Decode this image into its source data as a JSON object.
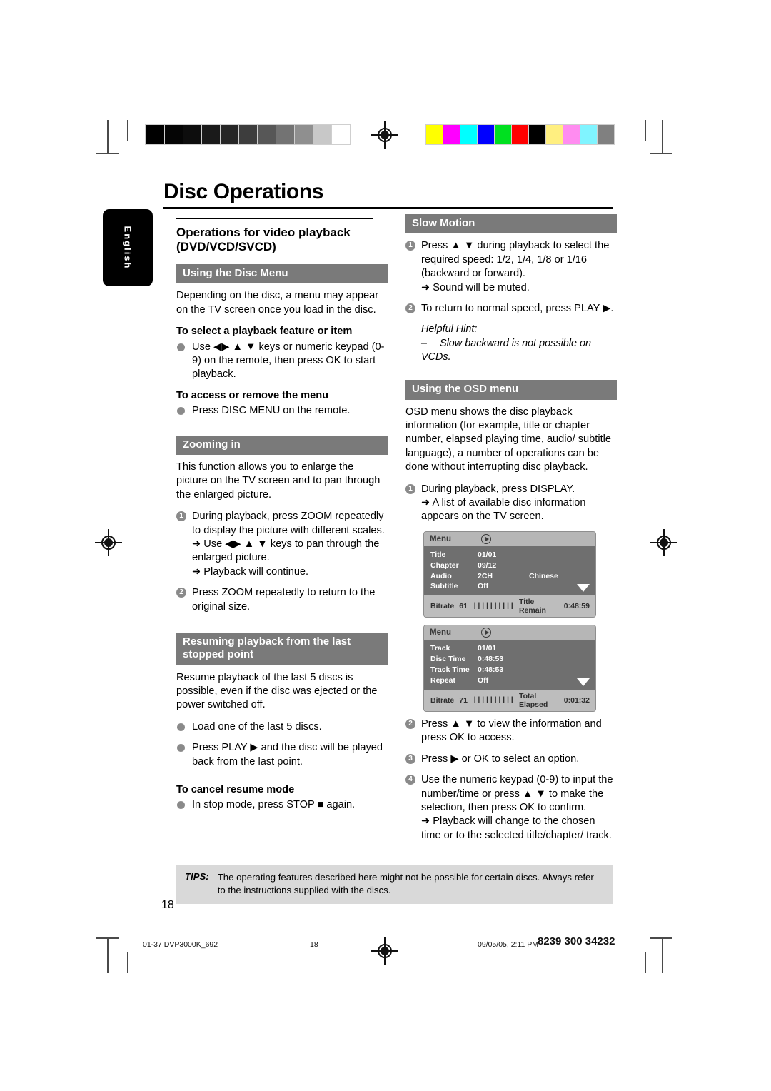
{
  "page": {
    "title": "Disc Operations",
    "language_tab": "English",
    "page_number": "18"
  },
  "calibration": {
    "grayscale": [
      "#000000",
      "#050505",
      "#0d0d0d",
      "#1a1a1a",
      "#262626",
      "#3d3d3d",
      "#575757",
      "#737373",
      "#8f8f8f",
      "#c8c8c8",
      "#ffffff"
    ],
    "colors": [
      "#ffff00",
      "#ff00ff",
      "#00ffff",
      "#0000ff",
      "#00e020",
      "#ff0000",
      "#000000",
      "#ffef80",
      "#ff8cf0",
      "#80f4ff",
      "#808080"
    ]
  },
  "left_column": {
    "section_title": "Operations for video playback (DVD/VCD/SVCD)",
    "disc_menu": {
      "bar": "Using the Disc Menu",
      "intro": "Depending on the disc, a menu may appear on the TV screen once you load in the disc.",
      "sub1": "To select a playback feature or item",
      "item1": "Use ◀▶ ▲ ▼ keys or numeric keypad (0-9) on the remote, then press OK to start playback.",
      "sub2": "To access or remove the menu",
      "item2": "Press DISC MENU on the remote."
    },
    "zooming": {
      "bar": "Zooming in",
      "intro": "This function allows you to enlarge the picture on the TV screen and to pan through the enlarged picture.",
      "step1": "During playback, press ZOOM repeatedly to display the picture with different scales.",
      "step1_arrow1": "➜ Use ◀▶ ▲ ▼ keys to pan through the enlarged picture.",
      "step1_arrow2": "➜ Playback will continue.",
      "step2": "Press ZOOM repeatedly to return to the original size."
    },
    "resuming": {
      "bar": "Resuming playback from the last stopped point",
      "intro": "Resume playback of the last 5 discs is possible, even if the disc was ejected or the power switched off.",
      "item1": "Load one of the last 5 discs.",
      "item2": "Press PLAY ▶ and the disc will be played back from the last point.",
      "sub": "To cancel resume mode",
      "item3": "In stop mode, press STOP ■ again."
    }
  },
  "right_column": {
    "slow_motion": {
      "bar": "Slow Motion",
      "step1": "Press ▲ ▼ during playback to select the required speed: 1/2, 1/4, 1/8 or 1/16 (backward or forward).",
      "step1_arrow": "➜ Sound will be muted.",
      "step2": "To return to normal speed, press PLAY ▶.",
      "hint_label": "Helpful Hint:",
      "hint_text": "Slow backward is not possible on VCDs."
    },
    "osd": {
      "bar": "Using the OSD menu",
      "intro": "OSD menu shows the disc playback information (for example, title or chapter number, elapsed playing time, audio/ subtitle language), a number of operations can be done without interrupting disc playback.",
      "step1": "During playback, press DISPLAY.",
      "step1_arrow": "➜ A list of available disc information appears on the TV screen.",
      "step2": "Press ▲ ▼ to view the information and press OK to access.",
      "step3": "Press ▶ or OK to select an option.",
      "step4": "Use the numeric keypad (0-9) to input the number/time or press ▲ ▼ to make the selection, then press OK to confirm.",
      "step4_arrow": "➜ Playback will change to the chosen time or to the selected title/chapter/ track."
    },
    "osd_screen_dvd": {
      "header": "Menu",
      "rows": [
        {
          "key": "Title",
          "value": "01/01",
          "extra": ""
        },
        {
          "key": "Chapter",
          "value": "09/12",
          "extra": ""
        },
        {
          "key": "Audio",
          "value": "2CH",
          "extra": "Chinese"
        },
        {
          "key": "Subtitle",
          "value": "Off",
          "extra": ""
        }
      ],
      "footer": {
        "bitrate_label": "Bitrate",
        "bitrate_value": "61",
        "meter": "||||||||||",
        "remain_label": "Title Remain",
        "remain_value": "0:48:59"
      }
    },
    "osd_screen_cd": {
      "header": "Menu",
      "rows": [
        {
          "key": "Track",
          "value": "01/01",
          "extra": ""
        },
        {
          "key": "Disc Time",
          "value": "0:48:53",
          "extra": ""
        },
        {
          "key": "Track Time",
          "value": "0:48:53",
          "extra": ""
        },
        {
          "key": "Repeat",
          "value": "Off",
          "extra": ""
        }
      ],
      "footer": {
        "bitrate_label": "Bitrate",
        "bitrate_value": "71",
        "meter": "||||||||||",
        "remain_label": "Total Elapsed",
        "remain_value": "0:01:32"
      }
    }
  },
  "tips": {
    "label": "TIPS:",
    "text": "The operating features described here might not be possible for certain discs.  Always refer to the instructions supplied with the discs."
  },
  "footer": {
    "file": "01-37 DVP3000K_692",
    "page": "18",
    "timestamp": "09/05/05, 2:11 PM",
    "code": "8239 300 34232"
  }
}
